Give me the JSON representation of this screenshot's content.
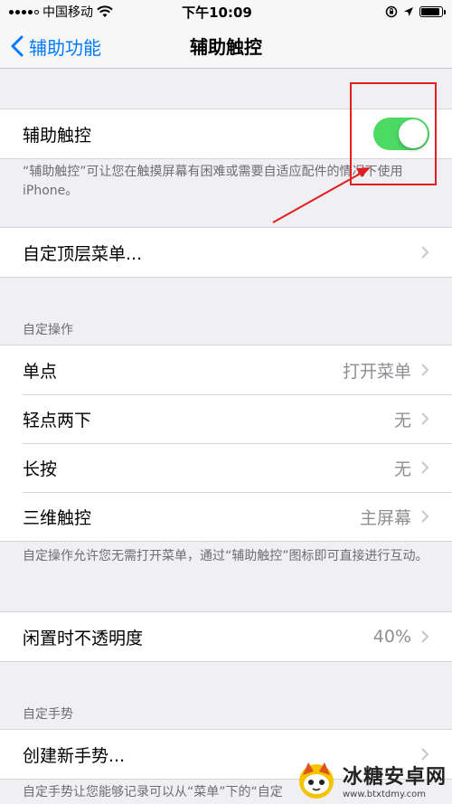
{
  "status_bar": {
    "carrier": "中国移动",
    "time": "下午10:09",
    "signal_bars": 4,
    "signal_total": 5,
    "battery_level_percent": 90
  },
  "navbar": {
    "back_label": "辅助功能",
    "title": "辅助触控"
  },
  "assistive_touch": {
    "label": "辅助触控",
    "toggle_on": true,
    "footnote": "“辅助触控”可让您在触摸屏幕有困难或需要自适应配件的情况下使用 iPhone。"
  },
  "top_level_menu": {
    "label": "自定顶层菜单..."
  },
  "custom_actions": {
    "header": "自定操作",
    "rows": [
      {
        "label": "单点",
        "value": "打开菜单"
      },
      {
        "label": "轻点两下",
        "value": "无"
      },
      {
        "label": "长按",
        "value": "无"
      },
      {
        "label": "三维触控",
        "value": "主屏幕"
      }
    ],
    "footnote": "自定操作允许您无需打开菜单，通过“辅助触控”图标即可直接进行互动。"
  },
  "idle_opacity": {
    "label": "闲置时不透明度",
    "value": "40%"
  },
  "custom_gestures": {
    "header": "自定手势",
    "create_label": "创建新手势...",
    "footnote": "自定手势让您能够记录可以从“菜单”下的“自定"
  },
  "watermark": {
    "title": "冰糖安卓网",
    "url": "www.btxtdmy.com"
  },
  "colors": {
    "accent": "#007aff",
    "toggle_on": "#4cd964",
    "annotation": "#e02020",
    "background": "#efeff4"
  }
}
